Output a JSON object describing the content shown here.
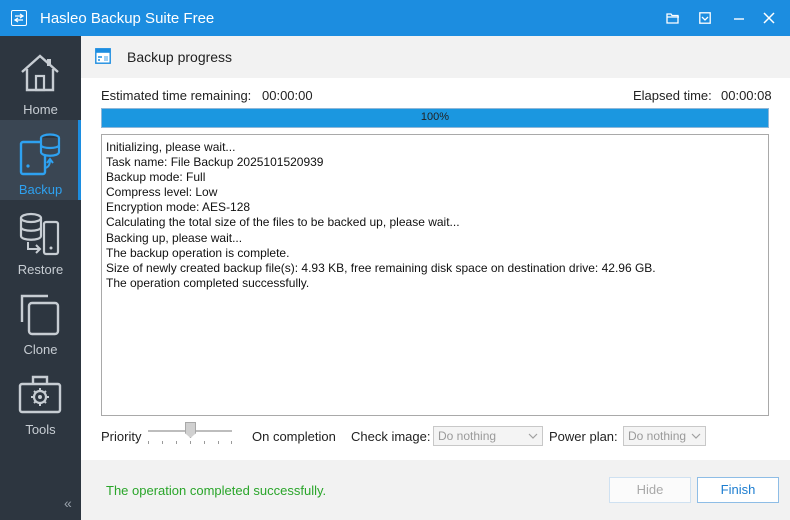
{
  "window": {
    "title": "Hasleo Backup Suite Free"
  },
  "sidebar": {
    "items": [
      {
        "label": "Home",
        "icon": "home-icon"
      },
      {
        "label": "Backup",
        "icon": "backup-icon",
        "active": true
      },
      {
        "label": "Restore",
        "icon": "restore-icon"
      },
      {
        "label": "Clone",
        "icon": "clone-icon"
      },
      {
        "label": "Tools",
        "icon": "tools-icon"
      }
    ],
    "collapse": "«"
  },
  "header": {
    "title": "Backup progress"
  },
  "progress": {
    "remaining_label": "Estimated time remaining:",
    "remaining_value": "00:00:00",
    "elapsed_label": "Elapsed time:",
    "elapsed_value": "00:00:08",
    "percent": 100,
    "percent_text": "100%"
  },
  "log": {
    "lines": [
      "Initializing, please wait...",
      "Task name: File Backup 2025101520939",
      "Backup mode: Full",
      "Compress level: Low",
      "Encryption mode: AES-128",
      "Calculating the total size of the files to be backed up, please wait...",
      "Backing up, please wait...",
      "The backup operation is complete.",
      "Size of newly created backup file(s): 4.93 KB, free remaining disk space on destination drive: 42.96 GB.",
      "The operation completed successfully."
    ]
  },
  "controls": {
    "priority_label": "Priority",
    "on_completion_label": "On completion",
    "check_image_label": "Check image:",
    "check_image_value": "Do nothing",
    "power_plan_label": "Power plan:",
    "power_plan_value": "Do nothing"
  },
  "footer": {
    "status": "The operation completed successfully.",
    "hide_label": "Hide",
    "finish_label": "Finish"
  },
  "colors": {
    "accent": "#1c8de0",
    "sidebar": "#2d3640",
    "success": "#2aa52a"
  }
}
